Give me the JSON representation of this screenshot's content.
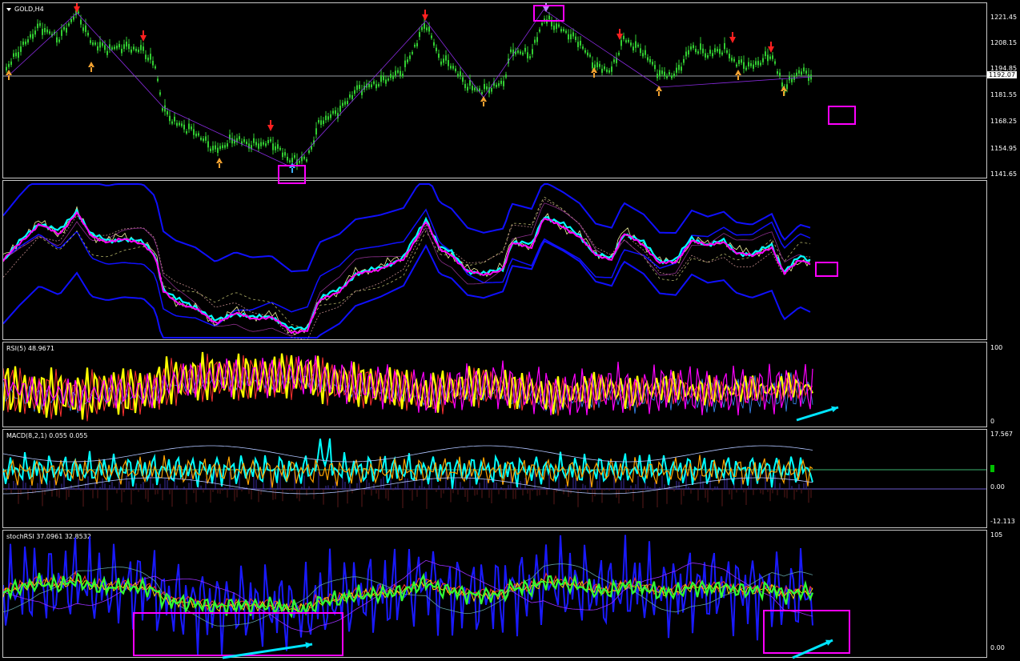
{
  "chart_title": "GOLD,H4",
  "price_axis": [
    "1221.45",
    "1208.15",
    "1194.85",
    "1181.55",
    "1168.25",
    "1154.95",
    "1141.65"
  ],
  "current_price": "1192.07",
  "rsi": {
    "label": "RSI(5) 48.9671",
    "ticks": [
      "100",
      "0"
    ]
  },
  "macd": {
    "label": "MACD(8,2,1) 0.055 0.055",
    "ticks": [
      "17.567",
      "0.00",
      "-12.113"
    ]
  },
  "stochrsi": {
    "label": "stochRSI 37.0961 32.8532",
    "ticks": [
      "105",
      "0.00"
    ]
  },
  "colors": {
    "bg": "#000000",
    "candle": "#32cd32",
    "band": "#1010ff",
    "ma": "#ff00ff",
    "fast": "#00ffff",
    "rsi": "#ffff00",
    "annot": "#ff00ff",
    "arrow_up": "#f0a030",
    "arrow_down": "#ff2020",
    "trend": "#00e5ff",
    "stoch": "#32ff32"
  }
}
